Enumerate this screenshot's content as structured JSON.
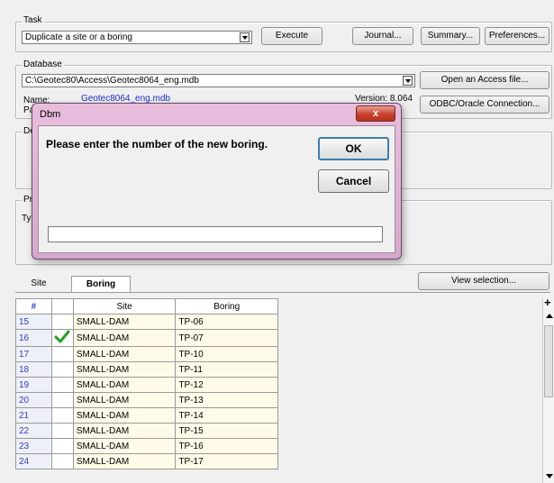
{
  "task": {
    "group_label": "Task",
    "selected_task": "Duplicate a site or a boring",
    "execute_label": "Execute",
    "journal_label": "Journal...",
    "summary_label": "Summary...",
    "preferences_label": "Preferences..."
  },
  "database": {
    "group_label": "Database",
    "path": "C:\\Geotec80\\Access\\Geotec8064_eng.mdb",
    "name_label": "Name:",
    "name_value": "Geotec8064_eng.mdb",
    "version": "Version: 8.064",
    "pa_label": "Pa",
    "open_access_label": "Open an Access file...",
    "odbc_label": "ODBC/Oracle Connection..."
  },
  "partial_labels": {
    "de": "De",
    "pr": "Pr",
    "ty": "Ty"
  },
  "dialog": {
    "title": "Dbm",
    "close_glyph": "x",
    "prompt": "Please enter the number of the new boring.",
    "ok_label": "OK",
    "cancel_label": "Cancel",
    "input_value": ""
  },
  "tabs": {
    "site": "Site",
    "boring": "Boring",
    "active": "Boring"
  },
  "view_selection_label": "View selection...",
  "grid": {
    "headers": [
      "#",
      "",
      "Site",
      "Boring"
    ],
    "rows": [
      {
        "num": "15",
        "check": false,
        "site": "SMALL-DAM",
        "boring": "TP-06"
      },
      {
        "num": "16",
        "check": true,
        "site": "SMALL-DAM",
        "boring": "TP-07"
      },
      {
        "num": "17",
        "check": false,
        "site": "SMALL-DAM",
        "boring": "TP-10"
      },
      {
        "num": "18",
        "check": false,
        "site": "SMALL-DAM",
        "boring": "TP-11"
      },
      {
        "num": "19",
        "check": false,
        "site": "SMALL-DAM",
        "boring": "TP-12"
      },
      {
        "num": "20",
        "check": false,
        "site": "SMALL-DAM",
        "boring": "TP-13"
      },
      {
        "num": "21",
        "check": false,
        "site": "SMALL-DAM",
        "boring": "TP-14"
      },
      {
        "num": "22",
        "check": false,
        "site": "SMALL-DAM",
        "boring": "TP-15"
      },
      {
        "num": "23",
        "check": false,
        "site": "SMALL-DAM",
        "boring": "TP-16"
      },
      {
        "num": "24",
        "check": false,
        "site": "SMALL-DAM",
        "boring": "TP-17"
      }
    ]
  },
  "scroll": {
    "plus_glyph": "+"
  },
  "colors": {
    "link": "#1a2ccf",
    "check": "#22a025",
    "dialog_frame": "#d9abcd"
  }
}
